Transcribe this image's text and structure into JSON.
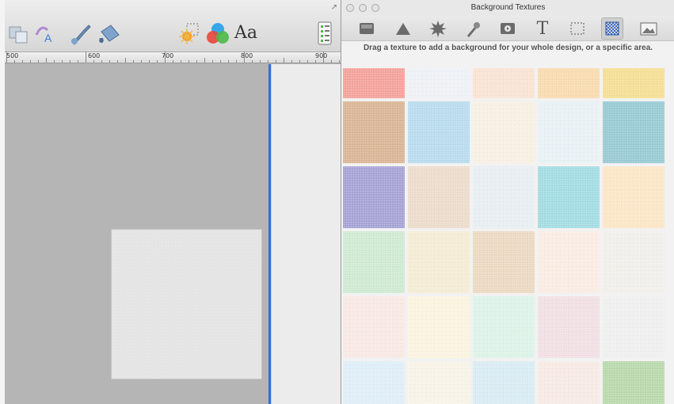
{
  "editor": {
    "ruler_labels": [
      "500",
      "600",
      "700",
      "800",
      "900"
    ],
    "text_tool_label": "Aa"
  },
  "panel": {
    "title": "Background Textures",
    "instructions": "Drag a texture to add a background for your whole design, or a specific area.",
    "tools": [
      "rectangle-icon",
      "triangle-icon",
      "starburst-icon",
      "brush-icon",
      "video-icon",
      "text-icon",
      "selection-icon",
      "texture-icon",
      "image-icon"
    ],
    "active_tool": "texture-icon"
  },
  "textures": [
    [
      "#f4a39b",
      "#eef1f5",
      "#f9e3d4",
      "#f8dcb0",
      "#f5df96"
    ],
    [
      "#d9b696",
      "#b9dcef",
      "#f7f0e2",
      "#e8f1f5",
      "#99cbd4"
    ],
    [
      "#a7a3d6",
      "#ecdccb",
      "#e8eef2",
      "#a3dde3",
      "#fbe6c7"
    ],
    [
      "#cfead2",
      "#f5ecd5",
      "#ecd9c2",
      "#f9ece3",
      "#f1efea"
    ],
    [
      "#f8e9e5",
      "#faf4df",
      "#def3e8",
      "#f1e0e5",
      "#efefef"
    ],
    [
      "#dfeef7",
      "#f8f3e8",
      "#d9ecf3",
      "#f7eae5",
      "#b9d9ad"
    ]
  ]
}
